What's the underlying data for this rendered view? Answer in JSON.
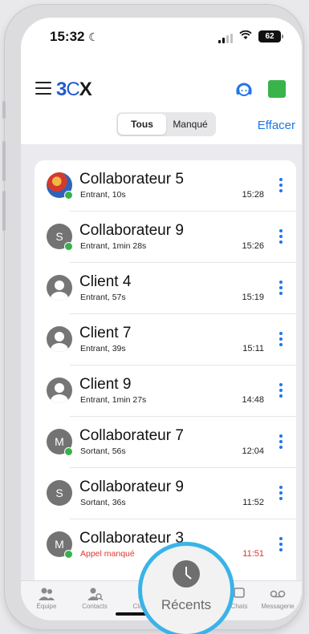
{
  "status_bar": {
    "time": "15:32",
    "battery": "62"
  },
  "header": {
    "logo": {
      "part1": "3",
      "part2": "C",
      "part3": "X"
    }
  },
  "filter": {
    "tabs": [
      "Tous",
      "Manqué"
    ],
    "active": "Tous"
  },
  "clear_label": "Effacer",
  "calls": [
    {
      "name": "Collaborateur 5",
      "detail": "Entrant, 10s",
      "time": "15:28",
      "avatar": "photo",
      "initial": "",
      "status": "available",
      "missed": false
    },
    {
      "name": "Collaborateur 9",
      "detail": "Entrant, 1min 28s",
      "time": "15:26",
      "avatar": "initial",
      "initial": "S",
      "status": "available",
      "missed": false
    },
    {
      "name": "Client 4",
      "detail": "Entrant, 57s",
      "time": "15:19",
      "avatar": "generic",
      "initial": "",
      "status": "",
      "missed": false
    },
    {
      "name": "Client 7",
      "detail": "Entrant, 39s",
      "time": "15:11",
      "avatar": "generic",
      "initial": "",
      "status": "",
      "missed": false
    },
    {
      "name": "Client 9",
      "detail": "Entrant, 1min 27s",
      "time": "14:48",
      "avatar": "generic",
      "initial": "",
      "status": "",
      "missed": false
    },
    {
      "name": "Collaborateur 7",
      "detail": "Sortant, 56s",
      "time": "12:04",
      "avatar": "initial",
      "initial": "M",
      "status": "available",
      "missed": false
    },
    {
      "name": "Collaborateur 9",
      "detail": "Sortant, 36s",
      "time": "11:52",
      "avatar": "initial",
      "initial": "S",
      "status": "",
      "missed": false
    },
    {
      "name": "Collaborateur 3",
      "detail": "Appel manqué",
      "time": "11:51",
      "avatar": "initial",
      "initial": "M",
      "status": "available",
      "missed": true
    }
  ],
  "tabbar": {
    "items": [
      {
        "label": "Équipe",
        "icon": "team-icon"
      },
      {
        "label": "Contacts",
        "icon": "contacts-icon"
      },
      {
        "label": "Clavier",
        "icon": "keypad-icon"
      },
      {
        "label": "Chats",
        "icon": "chats-icon"
      },
      {
        "label": "Messagerie",
        "icon": "voicemail-icon"
      }
    ],
    "focused": {
      "label": "Récents",
      "icon": "clock-icon"
    }
  },
  "colors": {
    "accent": "#1f76ea",
    "online": "#37b24a",
    "missed": "#e1352e",
    "focus_ring": "#3ab3e8",
    "logo_blue": "#2159d4"
  }
}
